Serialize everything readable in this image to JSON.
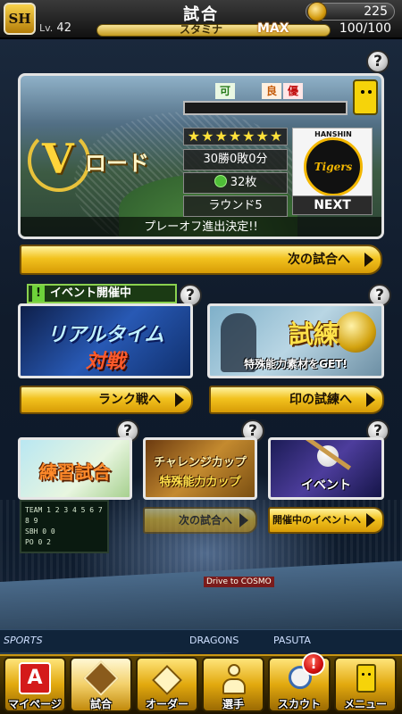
{
  "header": {
    "logo_text": "SH",
    "title": "試合",
    "coins": "225",
    "level_prefix": "Lv.",
    "level": "42",
    "stamina_label": "スタミナ",
    "stamina_max": "MAX",
    "stamina_count": "100/100"
  },
  "vroad": {
    "logo_letter": "V",
    "logo_text": "ロード",
    "flags": [
      "可",
      "良",
      "優"
    ],
    "stars": "★★★★★★★",
    "record": "30勝0敗0分",
    "tickets": "32枚",
    "round": "ラウンド5",
    "team_top": "HANSHIN",
    "team_name": "Tigers",
    "next_label": "NEXT",
    "status": "プレーオフ進出決定!!",
    "next_game_button": "次の試合へ"
  },
  "events": {
    "event_tag": "イベント開催中",
    "realtime": {
      "title": "リアルタイム",
      "subtitle": "対戦",
      "button": "ランク戦へ"
    },
    "trial": {
      "title": "試練",
      "subtitle": "特殊能力素材をGET!",
      "button": "印の試練へ"
    },
    "practice": {
      "title": "練習試合"
    },
    "challenge": {
      "title": "チャレンジカップ",
      "subtitle": "特殊能力カップ",
      "button": "次の試合へ"
    },
    "event": {
      "title": "イベント",
      "button": "開催中のイベントへ"
    }
  },
  "background": {
    "scoreboard": [
      "TEAM  1 2 3 4 5 6 7 8 9",
      "SBH  0 0",
      "PO  0 2"
    ],
    "signs": [
      "Drive to COSMO",
      "PASUTA",
      "DRAGONS",
      "SPORTS"
    ]
  },
  "nav": {
    "items": [
      {
        "label": "マイページ",
        "icon": "a-badge-icon"
      },
      {
        "label": "試合",
        "icon": "field-icon"
      },
      {
        "label": "オーダー",
        "icon": "diamond-icon"
      },
      {
        "label": "選手",
        "icon": "player-icon"
      },
      {
        "label": "スカウト",
        "icon": "scout-icon"
      },
      {
        "label": "メニュー",
        "icon": "mascot-icon"
      }
    ],
    "scout_badge": "!"
  },
  "colors": {
    "gold": "#f2c21e",
    "header": "#111111",
    "event_green": "#8ad14f"
  }
}
